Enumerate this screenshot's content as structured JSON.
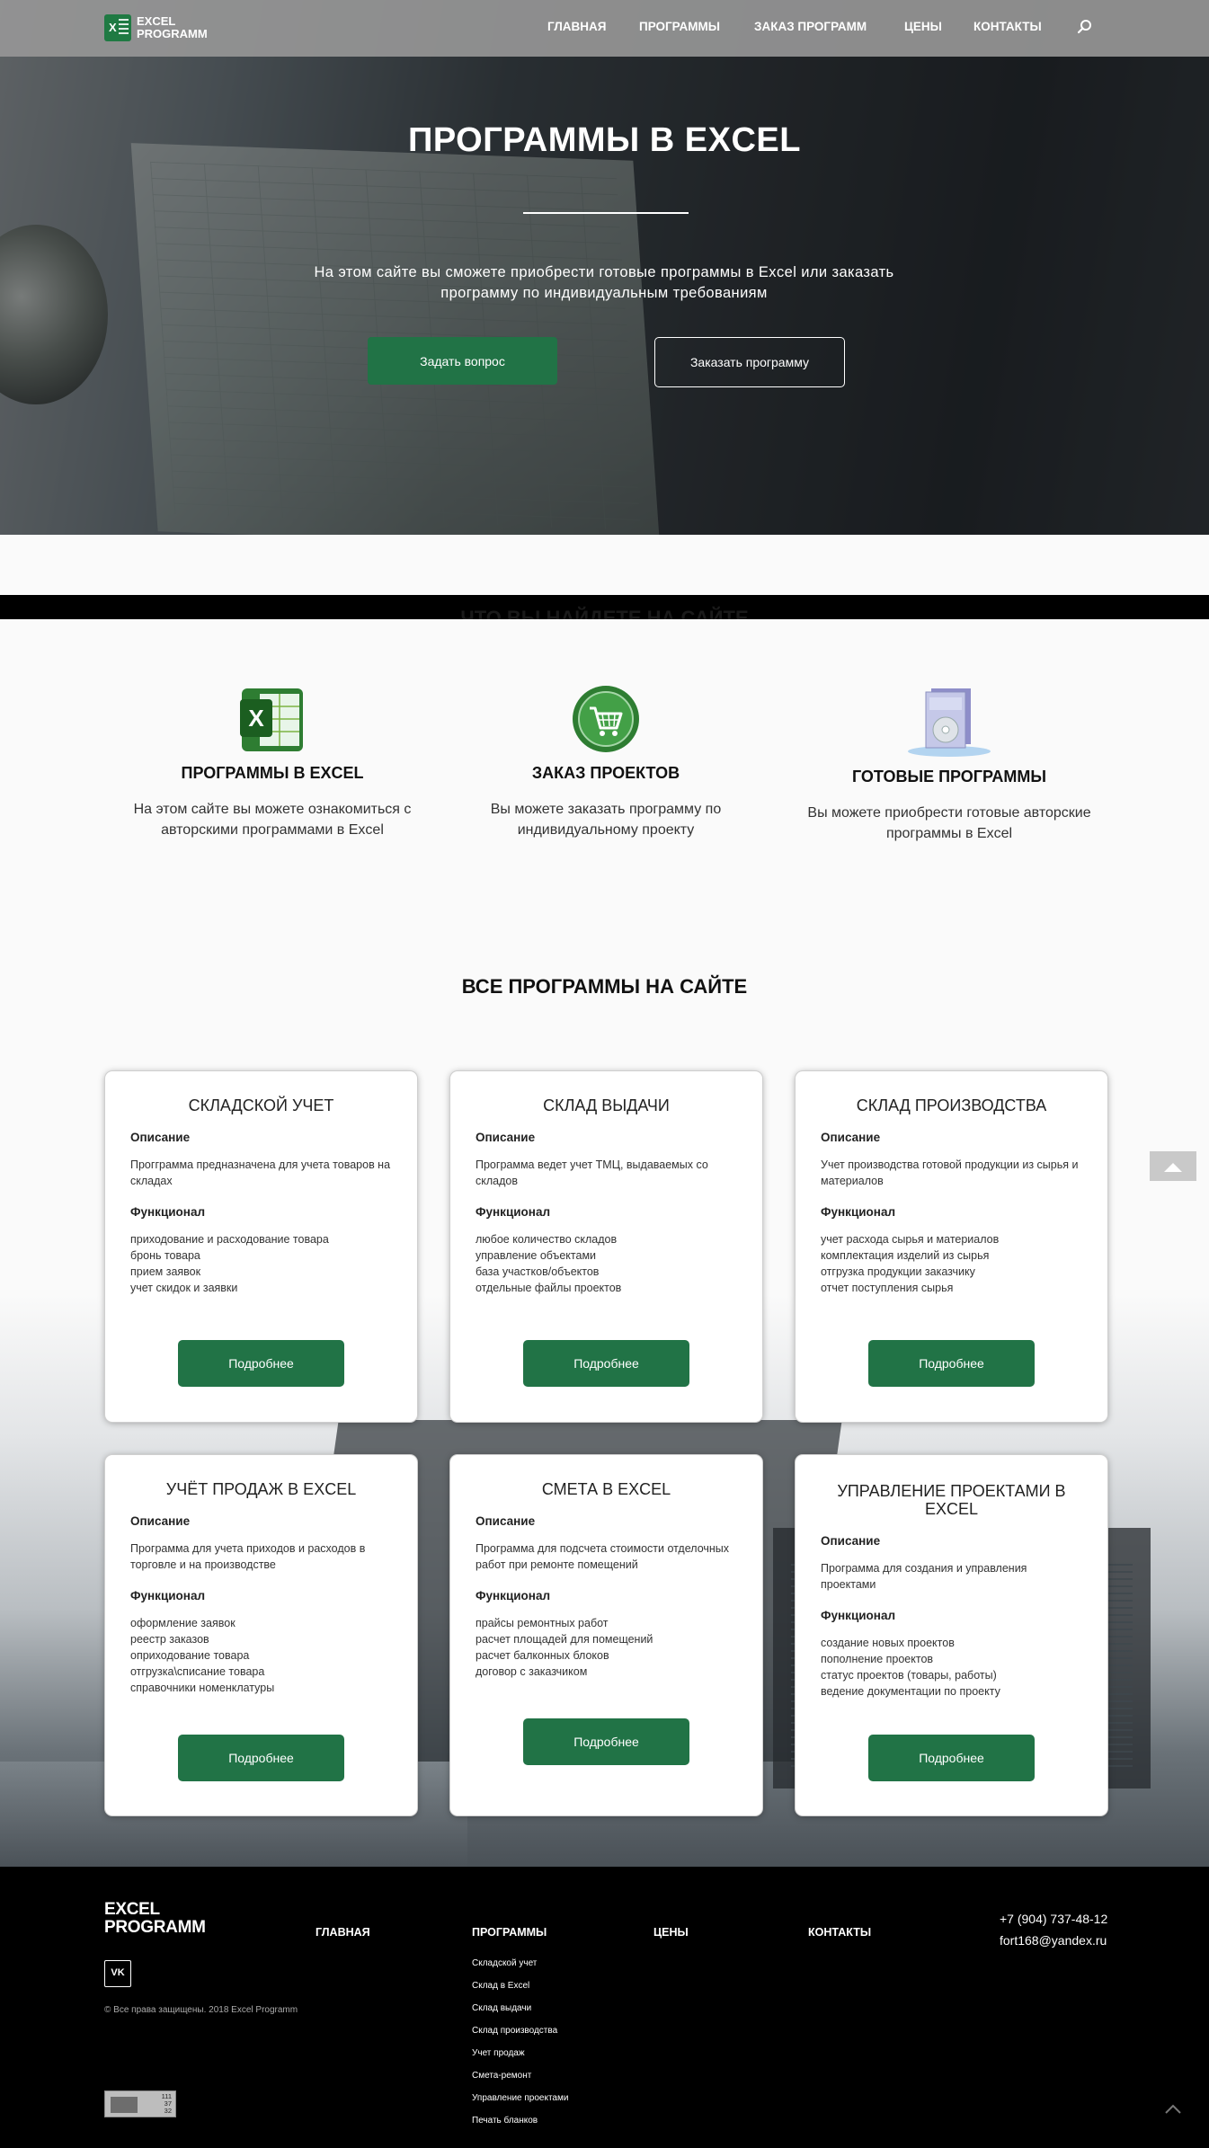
{
  "nav": {
    "logo_line1": "EXCEL",
    "logo_line2": "PROGRAMM",
    "logo_letter": "X",
    "items": [
      "ГЛАВНАЯ",
      "ПРОГРАММЫ",
      "ЗАКАЗ ПРОГРАММ",
      "ЦЕНЫ",
      "КОНТАКТЫ"
    ]
  },
  "hero": {
    "title": "ПРОГРАММЫ В EXCEL",
    "subtitle": "На этом сайте вы сможете приобрести готовые программы в Excel или заказать программу по индивидуальным требованиям",
    "ask_button": "Задать вопрос",
    "order_button": "Заказать программу"
  },
  "band": {
    "title": "ЧТО ВЫ НАЙДЕТЕ НА САЙТЕ"
  },
  "features": [
    {
      "icon": "excel-icon",
      "title": "ПРОГРАММЫ В EXCEL",
      "text": "На этом сайте вы можете ознакомиться с авторскими программами в Excel"
    },
    {
      "icon": "cart-icon",
      "title": "ЗАКАЗ ПРОЕКТОВ",
      "text": "Вы можете заказать программу по индивидуальному проекту"
    },
    {
      "icon": "software-box-icon",
      "title": "ГОТОВЫЕ ПРОГРАММЫ",
      "text": "Вы можете приобрести готовые авторские программы в Excel"
    }
  ],
  "programs_title": "ВСЕ ПРОГРАММЫ НА САЙТЕ",
  "cards": [
    {
      "title": "СКЛАДСКОЙ УЧЕТ",
      "desc_label": "Описание",
      "desc": "Прогграмма предназначена для учета товаров на складах",
      "func_label": "Функционал",
      "items": [
        "приходование и расходование товара",
        "бронь товара",
        "прием заявок",
        "учет скидок и заявки"
      ],
      "button": "Подробнее"
    },
    {
      "title": "СКЛАД ВЫДАЧИ",
      "desc_label": "Описание",
      "desc": "Программа ведет учет ТМЦ, выдаваемых со складов",
      "func_label": "Функционал",
      "items": [
        "любое количество складов",
        "управление объектами",
        "база участков/объектов",
        "отдельные файлы проектов"
      ],
      "button": "Подробнее"
    },
    {
      "title": "СКЛАД ПРОИЗВОДСТВА",
      "desc_label": "Описание",
      "desc": "Учет производства готовой продукции из сырья и материалов",
      "func_label": "Функционал",
      "items": [
        "учет расхода сырья и материалов",
        "комплектация изделий из сырья",
        "отгрузка продукции заказчику",
        "отчет поступления сырья"
      ],
      "button": "Подробнее"
    },
    {
      "title": "УЧЁТ ПРОДАЖ В EXCEL",
      "desc_label": "Описание",
      "desc": "Программа для учета приходов и расходов в торговле и на производстве",
      "func_label": "Функционал",
      "items": [
        "оформление заявок",
        "реестр заказов",
        "оприходование товара",
        "отгрузка\\списание товара",
        "справочники номенклатуры"
      ],
      "button": "Подробнее"
    },
    {
      "title": "СМЕТА В EXCEL",
      "desc_label": "Описание",
      "desc": "Программа для подсчета стоимости отделочных работ при ремонте помещений",
      "func_label": "Функционал",
      "items": [
        "прайсы ремонтных работ",
        "расчет площадей для помещений",
        "расчет балконных блоков",
        "договор с заказчиком"
      ],
      "button": "Подробнее"
    },
    {
      "title": "УПРАВЛЕНИЕ ПРОЕКТАМИ В EXCEL",
      "desc_label": "Описание",
      "desc": "Программа для создания и управления проектами",
      "func_label": "Функционал",
      "items": [
        "создание новых проектов",
        "пополнение проектов",
        "статус проектов (товары, работы)",
        "ведение документации по проекту"
      ],
      "button": "Подробнее"
    }
  ],
  "footer": {
    "logo_line1": "EXCEL",
    "logo_line2": "PROGRAMM",
    "vk": "VK",
    "copyright": "© Все права защищены. 2018 Excel Programm",
    "col_main": "ГЛАВНАЯ",
    "col_programs": "ПРОГРАММЫ",
    "col_prices": "ЦЕНЫ",
    "col_contacts": "КОНТАКТЫ",
    "program_links": [
      "Складской учет",
      "Склад в Excel",
      "Склад выдачи",
      "Склад производства",
      "Учет продаж",
      "Смета-ремонт",
      "Управление проектами",
      "Печать бланков"
    ],
    "phone": "+7 (904) 737-48-12",
    "email": "fort168@yandex.ru",
    "counter": [
      "111",
      "37",
      "32"
    ]
  },
  "colors": {
    "accent": "#217346",
    "footer_bg": "#000000",
    "nav_bg": "#969696"
  }
}
